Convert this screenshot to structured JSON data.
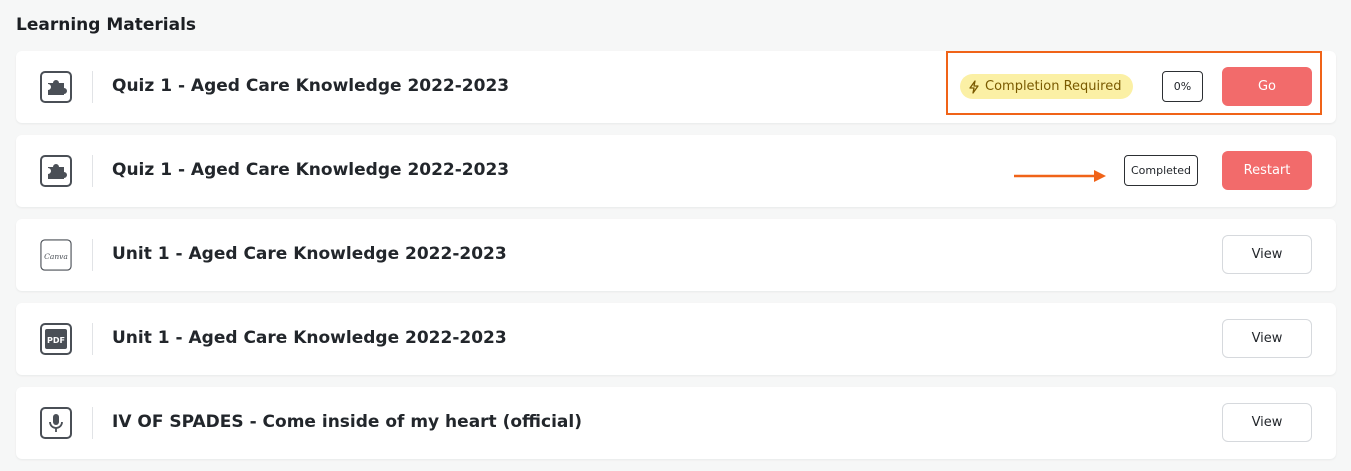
{
  "section": {
    "title": "Learning Materials"
  },
  "items": [
    {
      "icon": "puzzle-icon",
      "title": "Quiz 1 - Aged Care Knowledge 2022-2023",
      "badge": "Completion Required",
      "progress": "0%",
      "action": "Go"
    },
    {
      "icon": "puzzle-icon",
      "title": "Quiz 1 - Aged Care Knowledge 2022-2023",
      "status": "Completed",
      "action": "Restart"
    },
    {
      "icon": "canva-icon",
      "icon_text": "Canva",
      "title": "Unit 1 - Aged Care Knowledge 2022-2023",
      "action": "View"
    },
    {
      "icon": "pdf-icon",
      "icon_text": "PDF",
      "title": "Unit 1 - Aged Care Knowledge 2022-2023",
      "action": "View"
    },
    {
      "icon": "microphone-icon",
      "title": "IV OF SPADES - Come inside of my heart (official)",
      "action": "View"
    }
  ],
  "colors": {
    "primary_button": "#f26b6b",
    "badge_bg": "#fbf0a5",
    "annotation": "#f06318"
  }
}
